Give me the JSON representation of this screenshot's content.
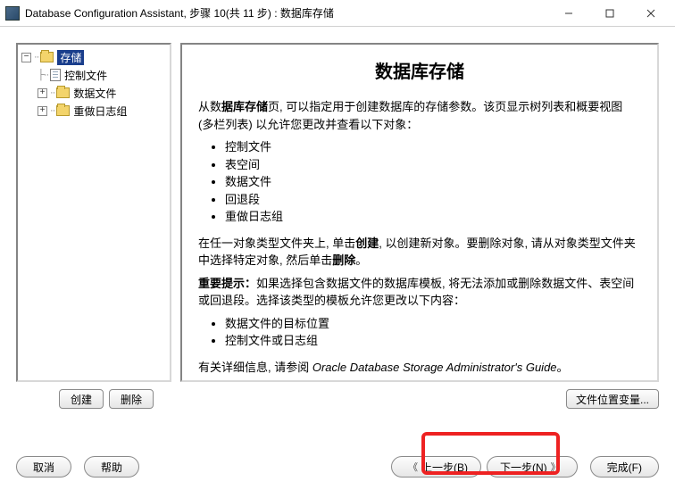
{
  "window": {
    "title": "Database Configuration Assistant, 步骤 10(共 11 步) : 数据库存储"
  },
  "tree": {
    "root": {
      "label": "存储",
      "selected": true
    },
    "items": [
      {
        "label": "控制文件"
      },
      {
        "label": "数据文件"
      },
      {
        "label": "重做日志组"
      }
    ]
  },
  "content": {
    "heading": "数据库存储",
    "intro_pre": "从数",
    "intro_bold": "据库存储",
    "intro_post": "页, 可以指定用于创建数据库的存储参数。该页显示树列表和概要视图 (多栏列表) 以允许您更改并查看以下对象：",
    "list1": [
      "控制文件",
      "表空间",
      "数据文件",
      "回退段",
      "重做日志组"
    ],
    "para2_pre": "在任一对象类型文件夹上, 单击",
    "para2_b1": "创建",
    "para2_mid": ", 以创建新对象。要删除对象, 请从对象类型文件夹中选择特定对象, 然后单击",
    "para2_b2": "删除",
    "para2_post": "。",
    "tip_label": "重要提示：",
    "tip_text": "如果选择包含数据文件的数据库模板, 将无法添加或删除数据文件、表空间或回退段。选择该类型的模板允许您更改以下内容：",
    "list2": [
      "数据文件的目标位置",
      "控制文件或日志组"
    ],
    "guide_pre": "有关详细信息, 请参阅 ",
    "guide_ital": "Oracle Database Storage Administrator's Guide",
    "guide_post": "。"
  },
  "buttons": {
    "create": "创建",
    "delete": "删除",
    "file_vars": "文件位置变量...",
    "cancel": "取消",
    "help": "帮助",
    "back": "上一步(B)",
    "next": "下一步(N)",
    "finish": "完成(F)"
  }
}
